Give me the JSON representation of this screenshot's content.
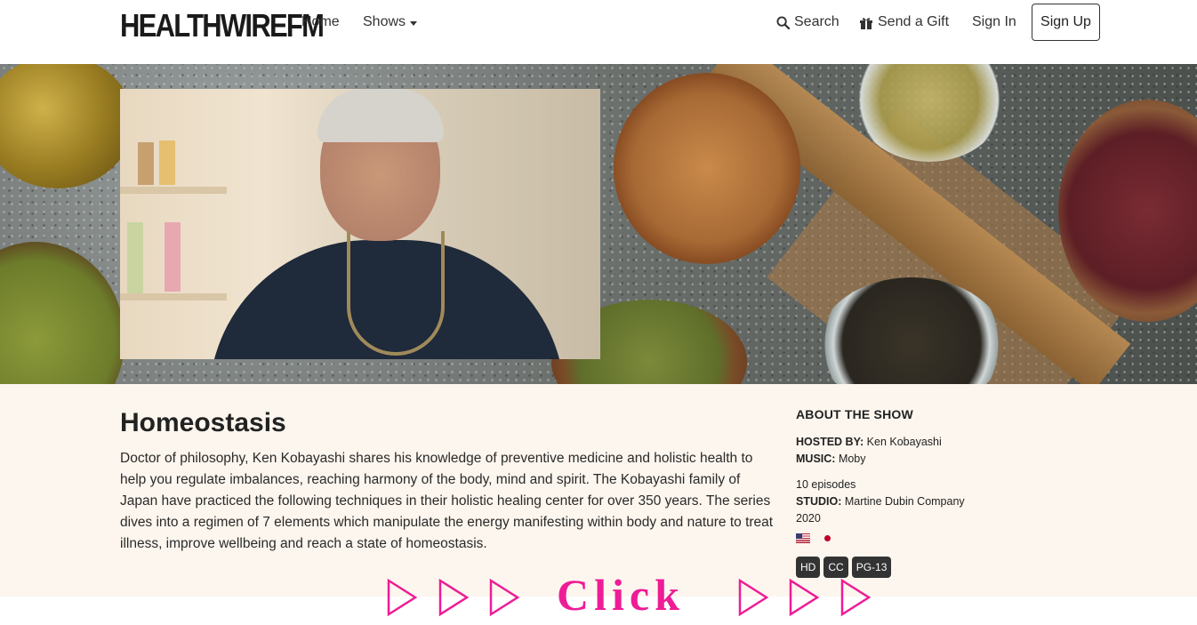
{
  "nav": {
    "logo": "HEALTHWIREFM",
    "home": "Home",
    "shows": "Shows",
    "search": "Search",
    "gift": "Send a Gift",
    "signin": "Sign In",
    "signup": "Sign Up"
  },
  "show": {
    "title": "Homeostasis",
    "description": "Doctor of philosophy, Ken Kobayashi shares his knowledge of preventive medicine and holistic health to help you regulate imbalances, reaching harmony of the body, mind and spirit. The Kobayashi family of Japan have practiced the following techniques in their holistic healing center for over 350 years. The series dives into a regimen of 7 elements which manipulate the energy manifesting within body and nature to treat illness, improve wellbeing and reach a state of homeostasis."
  },
  "about": {
    "heading": "ABOUT THE SHOW",
    "hosted_label": "HOSTED BY:",
    "hosted_value": "Ken Kobayashi",
    "music_label": "MUSIC:",
    "music_value": "Moby",
    "episodes": "10 episodes",
    "studio_label": "STUDIO:",
    "studio_value": "Martine Dubin Company",
    "year": "2020",
    "badges": [
      "HD",
      "CC",
      "PG-13"
    ]
  },
  "banner": {
    "text": "Click",
    "color": "#ee1c96"
  }
}
